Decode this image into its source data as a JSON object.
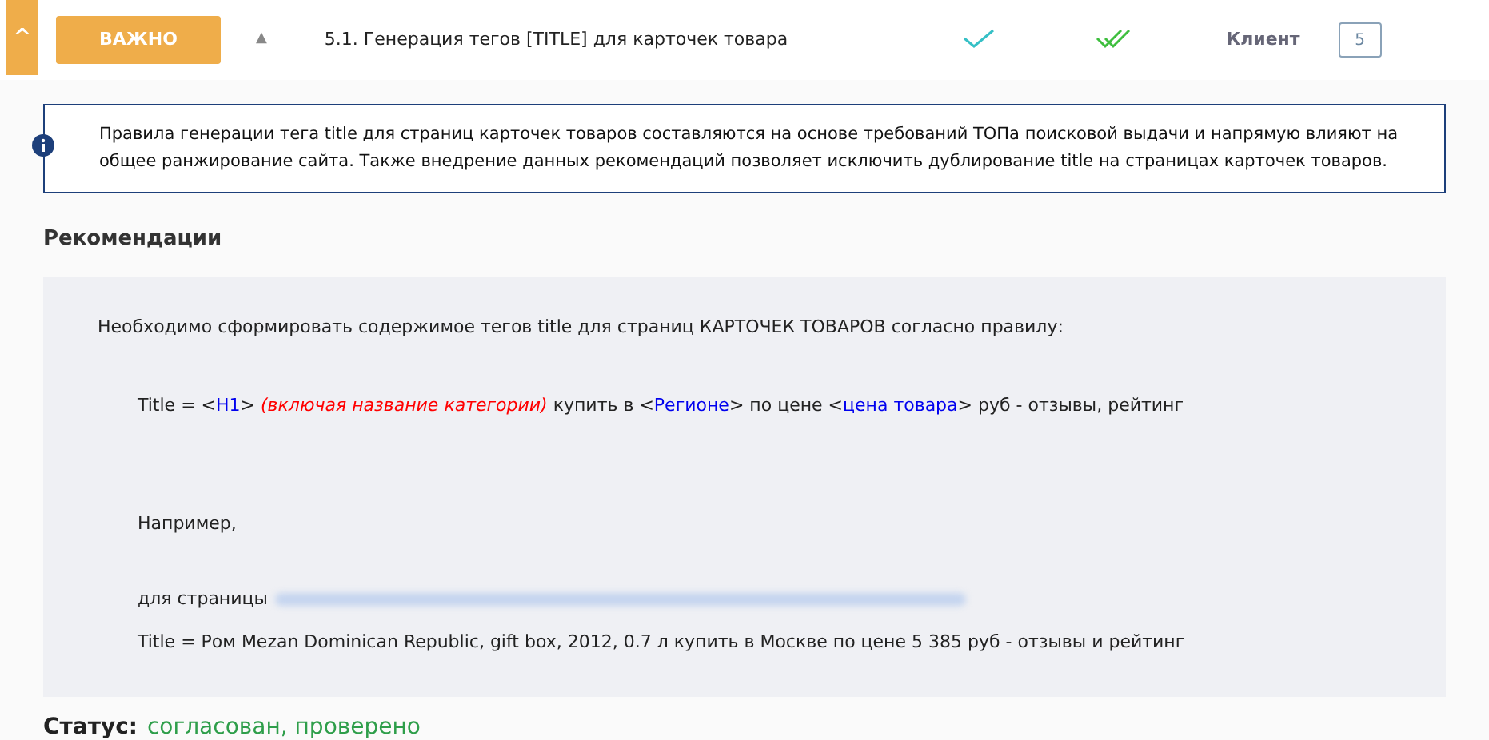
{
  "header": {
    "collapse": "^",
    "priority": "ВАЖНО",
    "sort": "▲",
    "title": "5.1. Генерация тегов [TITLE] для карточек товара",
    "checked": true,
    "approved": true,
    "role": "Клиент",
    "comments": "5"
  },
  "info": {
    "text": "Правила генерации тега title для страниц карточек товаров составляются на основе требований ТОПа поисковой выдачи и напрямую влияют на общее ранжирование сайта. Также внедрение данных рекомендаций позволяет исключить дублирование title на страницах карточек товаров."
  },
  "recommendations": {
    "heading": "Рекомендации",
    "intro": "Необходимо сформировать содержимое тегов title для страниц КАРТОЧЕК ТОВАРОВ согласно правилу:",
    "formula": [
      {
        "kind": "plain",
        "text": "Title = <"
      },
      {
        "kind": "var",
        "text": "H1"
      },
      {
        "kind": "plain",
        "text": "> "
      },
      {
        "kind": "note",
        "text": "(включая название категории)"
      },
      {
        "kind": "plain",
        "text": " купить в <"
      },
      {
        "kind": "var",
        "text": "Регионе"
      },
      {
        "kind": "plain",
        "text": "> по цене <"
      },
      {
        "kind": "var",
        "text": "цена товара"
      },
      {
        "kind": "plain",
        "text": "> руб - отзывы, рейтинг"
      }
    ],
    "example_label": "Например,",
    "page_label": "для страницы",
    "example": "Title = Ром Mezan Dominican Republic, gift box, 2012, 0.7 л купить в Москве по цене 5 385 руб - отзывы и рейтинг"
  },
  "status": {
    "label": "Статус:",
    "value": "согласован, проверено"
  }
}
